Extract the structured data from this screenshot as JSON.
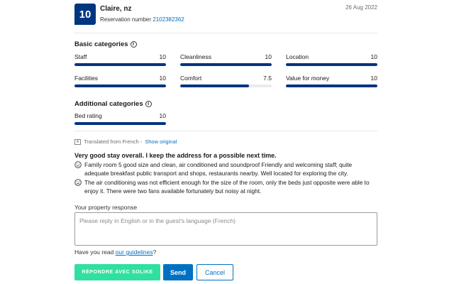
{
  "header": {
    "score": "10",
    "guest": "Claire, nz",
    "reservation_label": "Reservation number",
    "reservation_number": "2102382362",
    "date": "26 Aug 2022"
  },
  "basic": {
    "title": "Basic categories",
    "items": [
      {
        "label": "Staff",
        "score": "10",
        "fraction": 1.0
      },
      {
        "label": "Cleanliness",
        "score": "10",
        "fraction": 1.0
      },
      {
        "label": "Location",
        "score": "10",
        "fraction": 1.0
      },
      {
        "label": "Facilities",
        "score": "10",
        "fraction": 1.0
      },
      {
        "label": "Comfort",
        "score": "7.5",
        "fraction": 0.75
      },
      {
        "label": "Value for money",
        "score": "10",
        "fraction": 1.0
      }
    ]
  },
  "additional": {
    "title": "Additional categories",
    "items": [
      {
        "label": "Bed rating",
        "score": "10",
        "fraction": 1.0
      }
    ]
  },
  "translation": {
    "text": "Translated from French -",
    "link": "Show original"
  },
  "review": {
    "title": "Very good stay overall. I keep the address for a possible next time.",
    "positive": "Family room 5 good size and clean, air conditioned and soundproof Friendly and welcoming staff; quite adequate breakfast public transport and shops, restaurants nearby. Well located for exploring the city.",
    "negative": "The air conditioning was not efficient enough for the size of the room, only the beds just opposite were able to enjoy it. There were two fans available fortunately but noisy at night."
  },
  "response": {
    "label": "Your property response",
    "placeholder": "Please reply in English or in the guest's language (French)",
    "guidelines_prefix": "Have you read",
    "guidelines_link": "our guidelines",
    "guidelines_suffix": "?"
  },
  "buttons": {
    "solike": "RÉPONDRE AVEC SOLIKE",
    "send": "Send",
    "cancel": "Cancel"
  },
  "colors": {
    "brand": "#003580",
    "link": "#0071c2",
    "solike": "#2fe0a0"
  }
}
